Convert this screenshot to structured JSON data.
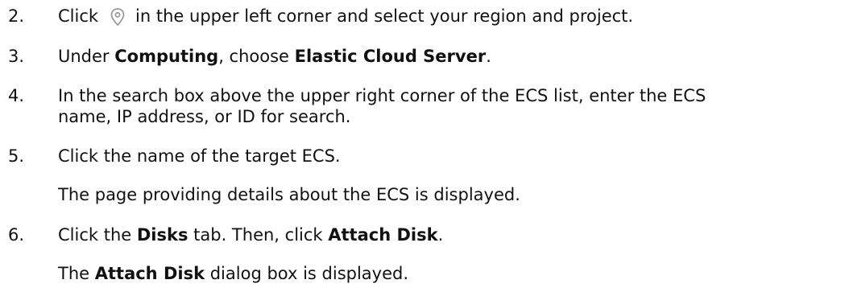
{
  "steps": [
    {
      "number": "2.",
      "pre": "Click",
      "icon": "location-pin-icon",
      "post": "in the upper left corner and select your region and project."
    },
    {
      "number": "3.",
      "a": "Under ",
      "b1": "Computing",
      "c": ", choose ",
      "b2": "Elastic Cloud Server",
      "d": "."
    },
    {
      "number": "4.",
      "line1": "In the search box above the upper right corner of the ECS list, enter the ECS",
      "line2": "name, IP address, or ID for search."
    },
    {
      "number": "5.",
      "text": "Click the name of the target ECS.",
      "result": "The page providing details about the ECS is displayed."
    },
    {
      "number": "6.",
      "a": "Click the ",
      "b1": "Disks",
      "c": " tab. Then, click ",
      "b2": "Attach Disk",
      "d": ".",
      "result_a": "The ",
      "result_b": "Attach Disk",
      "result_c": " dialog box is displayed."
    }
  ],
  "icon_color": "#9a9a9a"
}
